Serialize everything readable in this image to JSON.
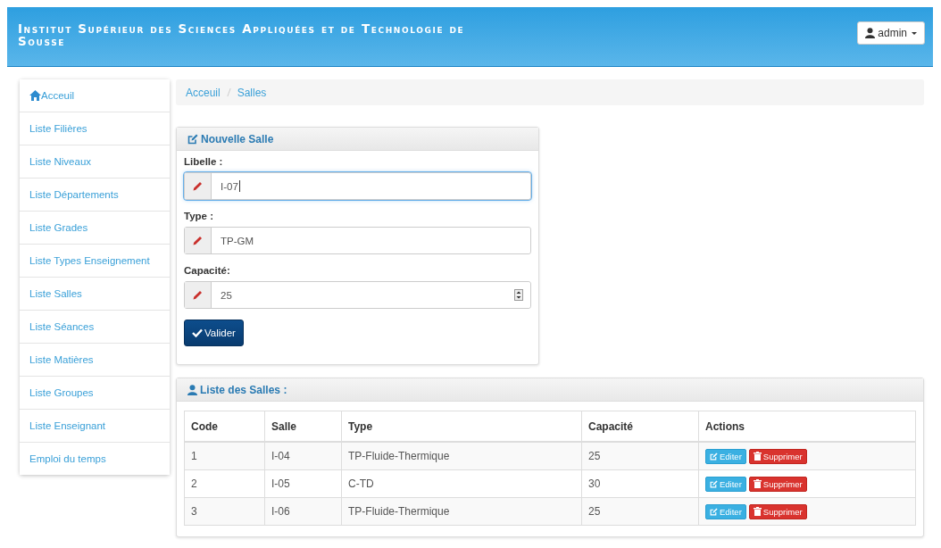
{
  "header": {
    "title": "Institut Supérieur des Sciences Appliquées et de Technologie de Sousse",
    "user_menu": "admin"
  },
  "sidebar": {
    "items": [
      {
        "label": "Acceuil",
        "kind": "home"
      },
      {
        "label": "Liste Filières",
        "kind": "link"
      },
      {
        "label": "Liste Niveaux",
        "kind": "link"
      },
      {
        "label": "Liste Départements",
        "kind": "link"
      },
      {
        "label": "Liste Grades",
        "kind": "link"
      },
      {
        "label": "Liste Types Enseignement",
        "kind": "link"
      },
      {
        "label": "Liste Salles",
        "kind": "link"
      },
      {
        "label": "Liste Séances",
        "kind": "link"
      },
      {
        "label": "Liste Matières",
        "kind": "link"
      },
      {
        "label": "Liste Groupes",
        "kind": "link"
      },
      {
        "label": "Liste Enseignant",
        "kind": "link"
      },
      {
        "label": "Emploi du temps",
        "kind": "link"
      }
    ]
  },
  "breadcrumb": [
    "Acceuil",
    "Salles"
  ],
  "form": {
    "title": "Nouvelle Salle",
    "fields": [
      {
        "label": "Libelle :",
        "value": "I-07",
        "kind": "text",
        "focused": true
      },
      {
        "label": "Type :",
        "value": "TP-GM",
        "kind": "text",
        "focused": false
      },
      {
        "label": "Capacité:",
        "value": "25",
        "kind": "number",
        "focused": false
      }
    ],
    "submit": "Valider"
  },
  "table": {
    "title": "Liste des Salles :",
    "columns": [
      "Code",
      "Salle",
      "Type",
      "Capacité",
      "Actions"
    ],
    "rows": [
      {
        "code": "1",
        "salle": "I-04",
        "type": "TP-Fluide-Thermique",
        "capacite": "25",
        "edit": "Editer",
        "delete": "Supprimer"
      },
      {
        "code": "2",
        "salle": "I-05",
        "type": "C-TD",
        "capacite": "30",
        "edit": "Editer",
        "delete": "Supprimer"
      },
      {
        "code": "3",
        "salle": "I-06",
        "type": "TP-Fluide-Thermique",
        "capacite": "25",
        "edit": "Editer",
        "delete": "Supprimer"
      }
    ]
  }
}
